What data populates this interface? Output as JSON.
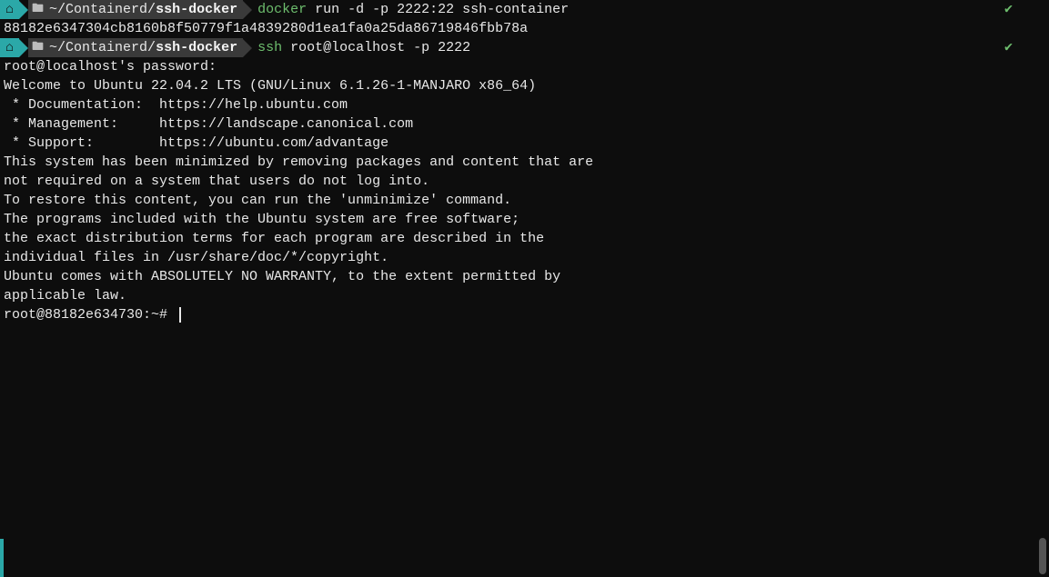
{
  "prompt1": {
    "icon": "⌂",
    "path_prefix": "~/Containerd/",
    "path_bold": "ssh-docker",
    "exe": "docker",
    "args": " run -d -p 2222:22 ssh-container",
    "check": "✔"
  },
  "output1": "88182e6347304cb8160b8f50779f1a4839280d1ea1fa0a25da86719846fbb78a",
  "prompt2": {
    "icon": "⌂",
    "path_prefix": "~/Containerd/",
    "path_bold": "ssh-docker",
    "exe": "ssh",
    "args": " root@localhost -p 2222",
    "check": "✔"
  },
  "motd": {
    "l0": "root@localhost's password:",
    "l1": "Welcome to Ubuntu 22.04.2 LTS (GNU/Linux 6.1.26-1-MANJARO x86_64)",
    "l2": "",
    "l3": " * Documentation:  https://help.ubuntu.com",
    "l4": " * Management:     https://landscape.canonical.com",
    "l5": " * Support:        https://ubuntu.com/advantage",
    "l6": "",
    "l7": "This system has been minimized by removing packages and content that are",
    "l8": "not required on a system that users do not log into.",
    "l9": "",
    "l10": "To restore this content, you can run the 'unminimize' command.",
    "l11": "",
    "l12": "The programs included with the Ubuntu system are free software;",
    "l13": "the exact distribution terms for each program are described in the",
    "l14": "individual files in /usr/share/doc/*/copyright.",
    "l15": "",
    "l16": "Ubuntu comes with ABSOLUTELY NO WARRANTY, to the extent permitted by",
    "l17": "applicable law.",
    "l18": ""
  },
  "shell_prompt": "root@88182e634730:~# "
}
